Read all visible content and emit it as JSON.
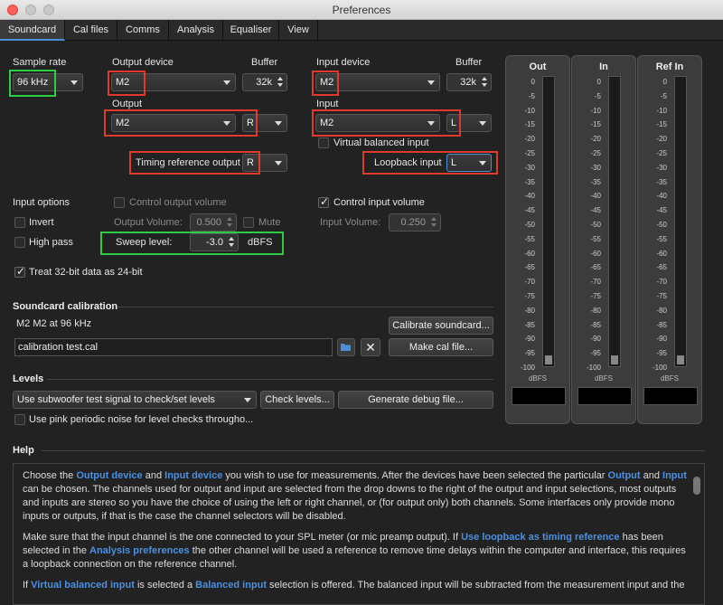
{
  "window": {
    "title": "Preferences"
  },
  "tabs": [
    "Soundcard",
    "Cal files",
    "Comms",
    "Analysis",
    "Equaliser",
    "View"
  ],
  "sample_rate": {
    "label": "Sample rate",
    "value": "96 kHz"
  },
  "output": {
    "device_label": "Output device",
    "device_value": "M2",
    "buffer_label": "Buffer",
    "buffer_value": "32k",
    "channel_label": "Output",
    "channel_value": "M2",
    "channel_side": "R",
    "timing_label": "Timing reference output",
    "timing_value": "R"
  },
  "input": {
    "device_label": "Input device",
    "device_value": "M2",
    "buffer_label": "Buffer",
    "buffer_value": "32k",
    "channel_label": "Input",
    "channel_value": "M2",
    "channel_side": "L",
    "virtual_balanced_label": "Virtual balanced input",
    "loopback_label": "Loopback input",
    "loopback_value": "L"
  },
  "options": {
    "input_options_label": "Input options",
    "invert_label": "Invert",
    "high_pass_label": "High pass",
    "control_output_label": "Control output volume",
    "output_volume_label": "Output Volume:",
    "output_volume_value": "0.500",
    "mute_label": "Mute",
    "control_input_label": "Control input volume",
    "input_volume_label": "Input Volume:",
    "input_volume_value": "0.250",
    "sweep_label": "Sweep level:",
    "sweep_value": "-3.0",
    "sweep_unit": "dBFS",
    "treat_label": "Treat 32-bit data as 24-bit"
  },
  "calibration": {
    "title": "Soundcard calibration",
    "status": "M2 M2 at 96 kHz",
    "file": "calibration test.cal",
    "calibrate_button": "Calibrate soundcard...",
    "make_button": "Make cal file..."
  },
  "levels": {
    "title": "Levels",
    "signal_value": "Use subwoofer test signal to check/set levels",
    "check_button": "Check levels...",
    "debug_button": "Generate debug file...",
    "pink_label": "Use pink periodic noise for level checks througho..."
  },
  "meters": [
    {
      "title": "Out",
      "level_pct": 3
    },
    {
      "title": "In",
      "level_pct": 3
    },
    {
      "title": "Ref In",
      "level_pct": 3
    }
  ],
  "meter_ticks": [
    "0",
    "-5",
    "-10",
    "-15",
    "-20",
    "-25",
    "-30",
    "-35",
    "-40",
    "-45",
    "-50",
    "-55",
    "-60",
    "-65",
    "-70",
    "-75",
    "-80",
    "-85",
    "-90",
    "-95",
    "-100"
  ],
  "meter_unit": "dBFS",
  "help": {
    "title": "Help",
    "p1": [
      {
        "t": "Choose the "
      },
      {
        "t": "Output device",
        "h": true
      },
      {
        "t": " and "
      },
      {
        "t": "Input device",
        "h": true
      },
      {
        "t": " you wish to use for measurements. After the devices have been selected the particular "
      },
      {
        "t": "Output",
        "h": true
      },
      {
        "t": " and "
      },
      {
        "t": "Input",
        "h": true
      },
      {
        "t": " can be chosen. The channels used for output and input are selected from the drop downs to the right of the output and input selections, most outputs and inputs are stereo so you have the choice of using the left or right channel, or (for output only) both channels. Some interfaces only provide mono inputs or outputs, if that is the case the channel selectors will be disabled."
      }
    ],
    "p2": [
      {
        "t": "Make sure that the input channel is the one connected to your SPL meter (or mic preamp output). If "
      },
      {
        "t": "Use loopback as timing reference",
        "h": true
      },
      {
        "t": " has been selected in the "
      },
      {
        "t": "Analysis preferences",
        "h": true
      },
      {
        "t": " the other channel will be used a reference to remove time delays within the computer and interface, this requires a loopback connection on the reference channel."
      }
    ],
    "p3": [
      {
        "t": "If "
      },
      {
        "t": "Virtual balanced input",
        "h": true
      },
      {
        "t": " is selected a "
      },
      {
        "t": "Balanced input",
        "h": true
      },
      {
        "t": " selection is offered. The balanced input will be subtracted from the measurement input and the"
      }
    ]
  }
}
